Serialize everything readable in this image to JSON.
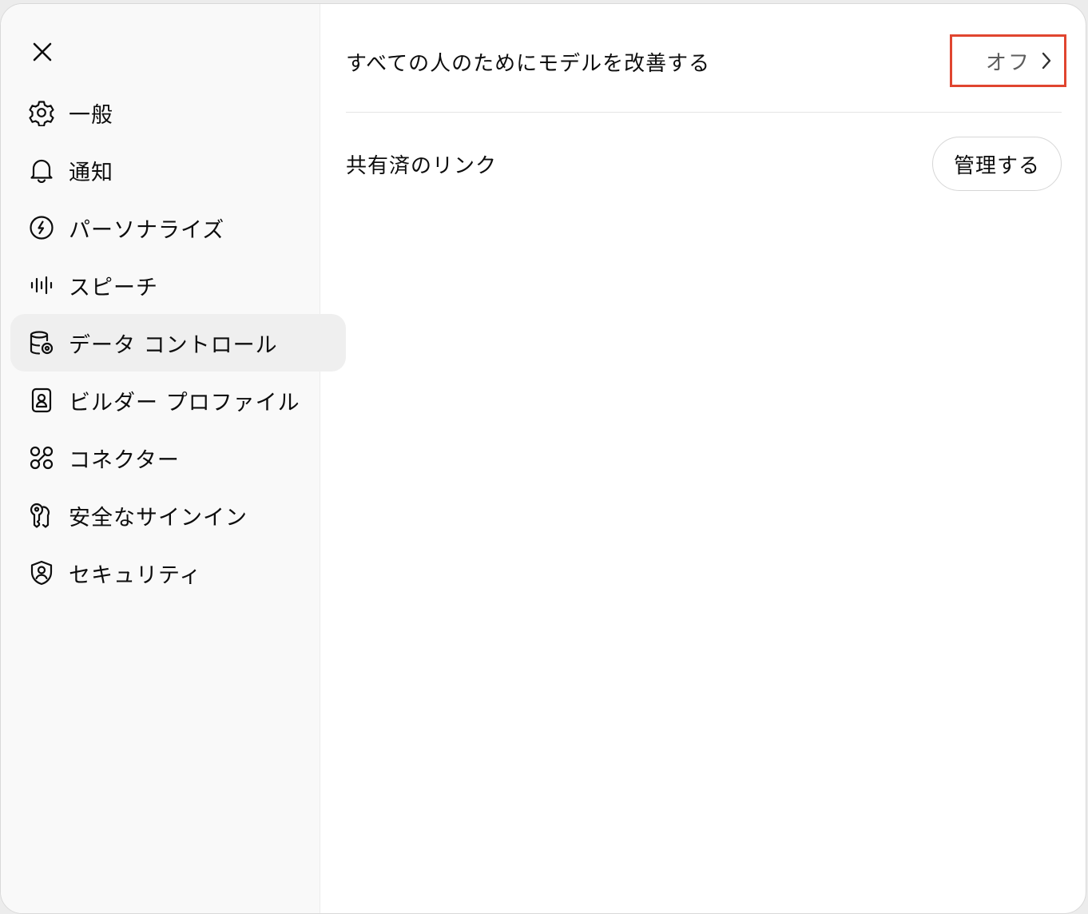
{
  "sidebar": {
    "close_icon": "close-icon",
    "items": [
      {
        "label": "一般",
        "icon": "gear-icon",
        "active": false
      },
      {
        "label": "通知",
        "icon": "bell-icon",
        "active": false
      },
      {
        "label": "パーソナライズ",
        "icon": "personalize-icon",
        "active": false
      },
      {
        "label": "スピーチ",
        "icon": "waveform-icon",
        "active": false
      },
      {
        "label": "データ コントロール",
        "icon": "database-gear-icon",
        "active": true
      },
      {
        "label": "ビルダー プロファイル",
        "icon": "profile-card-icon",
        "active": false
      },
      {
        "label": "コネクター",
        "icon": "connector-icon",
        "active": false
      },
      {
        "label": "安全なサインイン",
        "icon": "key-icon",
        "active": false
      },
      {
        "label": "セキュリティ",
        "icon": "shield-icon",
        "active": false
      }
    ]
  },
  "main": {
    "improve_model": {
      "label": "すべての人のためにモデルを改善する",
      "value": "オフ"
    },
    "shared_links": {
      "label": "共有済のリンク",
      "button": "管理する"
    }
  },
  "colors": {
    "highlight_border": "#e0452f",
    "active_item_bg": "#efefef",
    "sidebar_bg": "#f9f9f9"
  }
}
